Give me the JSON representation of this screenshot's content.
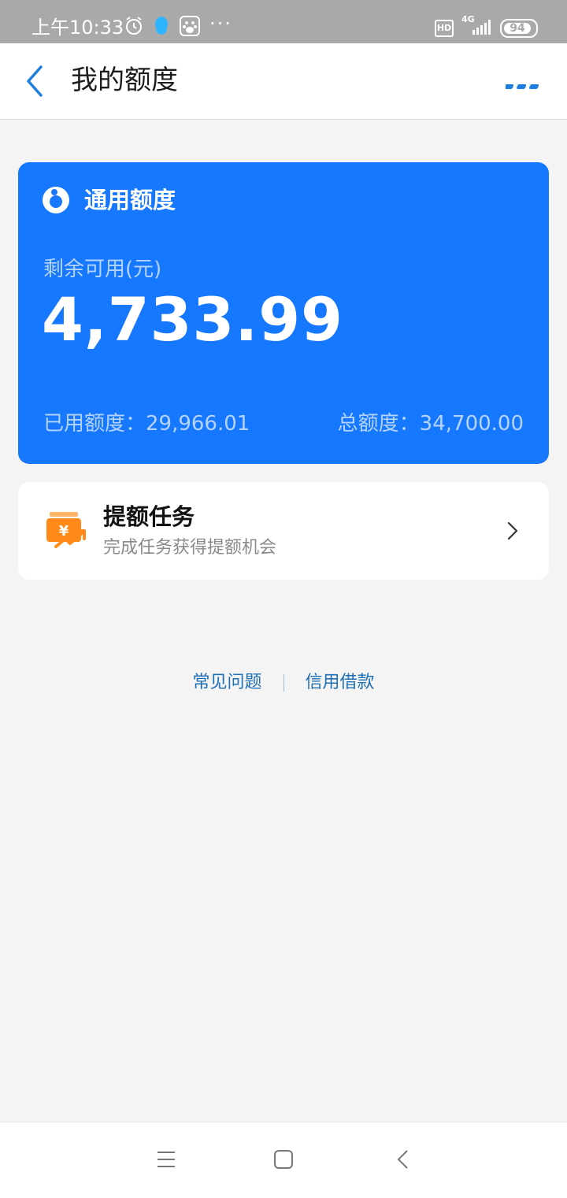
{
  "status_bar": {
    "time": "上午10:33",
    "network": "4G",
    "hd": "HD",
    "battery": "94",
    "icons": [
      "alarm-icon",
      "qq-icon",
      "baidu-icon",
      "more-dots-icon",
      "signal-icon"
    ]
  },
  "nav": {
    "title": "我的额度",
    "back_icon": "back-chevron-icon",
    "more_icon": "more-icon"
  },
  "credit_card": {
    "title": "通用额度",
    "available_label": "剩余可用(元)",
    "available_amount": "4,733.99",
    "used": "已用额度：29,966.01",
    "total": "总额度：34,700.00",
    "color": "#1677ff"
  },
  "task": {
    "title": "提额任务",
    "subtitle": "完成任务获得提额机会",
    "icon": "money-boost-icon",
    "icon_color": "#ff8a1a"
  },
  "links": {
    "faq": "常见问题",
    "loan": "信用借款"
  },
  "system_nav": {
    "icons": [
      "menu-icon",
      "home-icon",
      "back-icon"
    ]
  }
}
